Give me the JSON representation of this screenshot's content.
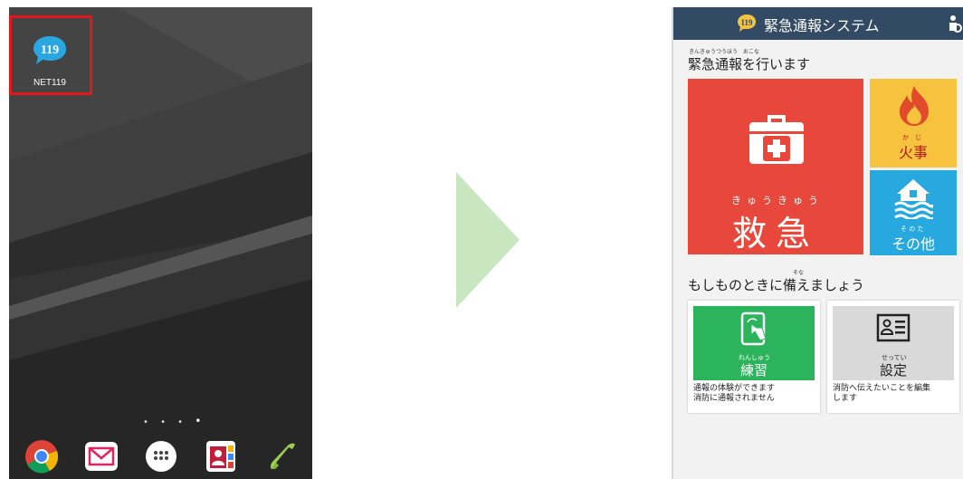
{
  "home_screen": {
    "app_icon": {
      "icon_number": "119",
      "label": "NET119"
    },
    "dock_icons": [
      "chrome-icon",
      "mail-icon",
      "app-drawer-icon",
      "contacts-icon",
      "phone-icon"
    ]
  },
  "app": {
    "header": {
      "logo_number": "119",
      "title": "緊急通報システム"
    },
    "emergency_section": {
      "heading_ruby": "きんきゅうつうほう　おこな",
      "heading": "緊急通報を行います"
    },
    "tiles": {
      "ambulance": {
        "ruby": "きゅうきゅう",
        "label": "救急"
      },
      "fire": {
        "ruby": "か　じ",
        "label": "火事"
      },
      "other": {
        "ruby": "そ の た",
        "label": "その他"
      }
    },
    "prepare_section": {
      "heading_ruby": "そな",
      "heading": "もしものときに備えましょう"
    },
    "cards": {
      "practice": {
        "ruby": "れんしゅう",
        "label": "練習",
        "desc_line1": "通報の体験ができます",
        "desc_line2": "消防に通報されません"
      },
      "settings": {
        "ruby": "せってい",
        "label": "設定",
        "desc_line1": "消防へ伝えたいことを編集",
        "desc_line2": "します"
      }
    }
  },
  "colors": {
    "header": "#324a63",
    "ambulance": "#e8473b",
    "fire": "#f7c23e",
    "other": "#27a8df",
    "practice": "#2bb45c",
    "settings": "#d9d9d9",
    "arrow": "#c8e6c0",
    "highlight": "#e3161b"
  }
}
